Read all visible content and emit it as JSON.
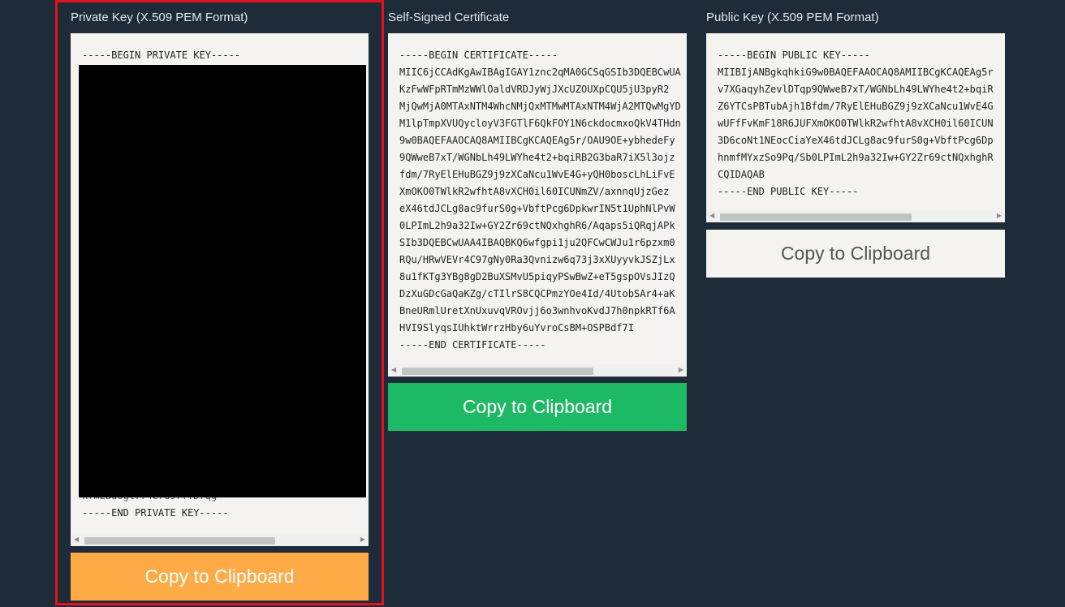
{
  "colors": {
    "background": "#1e2b38",
    "orange_button": "#ffab47",
    "green_button": "#1eb964",
    "light_button": "#f5f3f0",
    "highlight": "#e5121e"
  },
  "private_key": {
    "label": "Private Key (X.509 PEM Format)",
    "begin": "-----BEGIN PRIVATE KEY-----",
    "partial_line": "k7mzBd6gl774e7d97fYDrqg=",
    "end": "-----END PRIVATE KEY-----",
    "button": "Copy to Clipboard"
  },
  "certificate": {
    "label": "Self-Signed Certificate",
    "text": "-----BEGIN CERTIFICATE-----\nMIIC6jCCAdKgAwIBAgIGAY1znc2qMA0GCSqGSIb3DQEBCwUA\nKzFwWFpRTmMzWWlOaldVRDJyWjJXcUZOUXpCQU5jU3pyR2\nMjQwMjA0MTAxNTM4WhcNMjQxMTMwMTAxNTM4WjA2MTQwMgYD\nM1lpTmpXVUQycloyV3FGTlF6QkFOY1N6ckdocmxoQkV4THdn\n9w0BAQEFAAOCAQ8AMIIBCgKCAQEAg5r/OAU9OE+ybhedeFy\n9QWweB7xT/WGNbLh49LWYhe4t2+bqiRB2G3baR7iX5l3ojz\nfdm/7RyElEHuBGZ9j9zXCaNcu1WvE4G+yQH0boscLhLiFvE\nXmOKO0TWlkR2wfhtA8vXCH0il60ICUNmZV/axnnqUjzGez\neX46tdJCLg8ac9furS0g+VbftPcg6DpkwrIN5t1UphNlPvW\n0LPImL2h9a32Iw+GY2Zr69ctNQxhghR6/Aqaps5iQRqjAPk\nSIb3DQEBCwUAA4IBAQBKQ6wfgpi1ju2QFCwCWJu1r6pzxm0\nRQu/HRwVEVr4C97gNy0Ra3Qvnizw6q73j3xXUyyvkJSZjLx\n8u1fKTg3YBg8gD2BuXSMvU5piqyPSwBwZ+eT5gspOVsJIzQ\nDzXuGDcGaQaKZg/cTIlrS8CQCPmzYOe4Id/4UtobSAr4+aK\nBneURmlUretXnUxuvqVROvjj6o3wnhvoKvdJ7h0npkRTf6A\nHVI9SlyqsIUhktWrrzHby6uYvroCsBM+OSPBdf7I\n-----END CERTIFICATE-----",
    "button": "Copy to Clipboard"
  },
  "public_key": {
    "label": "Public Key (X.509 PEM Format)",
    "text": "-----BEGIN PUBLIC KEY-----\nMIIBIjANBgkqhkiG9w0BAQEFAAOCAQ8AMIIBCgKCAQEAg5r\nv7XGaqyhZevlDTqp9QWweB7xT/WGNbLh49LWYhe4t2+bqiR\nZ6YTCsPBTubAjh1Bfdm/7RyElEHuBGZ9j9zXCaNcu1WvE4G\nwUFfFvKmF18R6JUFXmOKO0TWlkR2wfhtA8vXCH0il60ICUN\n3D6coNt1NEocCiaYeX46tdJCLg8ac9furS0g+VbftPcg6Dp\nhnmfMYxzSo9Pq/Sb0LPImL2h9a32Iw+GY2Zr69ctNQxhghR\nCQIDAQAB\n-----END PUBLIC KEY-----",
    "button": "Copy to Clipboard"
  },
  "icons": {
    "scroll_left": "◀",
    "scroll_right": "▶"
  }
}
